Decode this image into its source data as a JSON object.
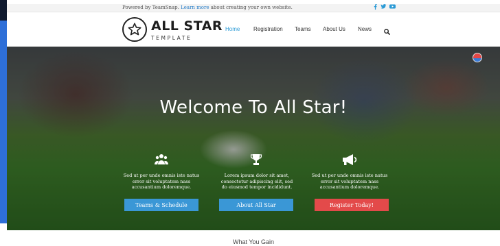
{
  "topbar": {
    "text_prefix": "Powered by TeamSnap. ",
    "link_text": "Learn more",
    "text_suffix": " about creating your own website.",
    "social_icons": [
      "facebook-icon",
      "twitter-icon",
      "youtube-icon"
    ]
  },
  "logo": {
    "main": "ALL STAR",
    "sub": "TEMPLATE"
  },
  "nav": {
    "items": [
      {
        "label": "Home",
        "active": true
      },
      {
        "label": "Registration",
        "active": false
      },
      {
        "label": "Teams",
        "active": false
      },
      {
        "label": "About Us",
        "active": false
      },
      {
        "label": "News",
        "active": false
      }
    ],
    "search_icon": "search-icon"
  },
  "hero": {
    "title": "Welcome To All Star!",
    "columns": [
      {
        "icon": "group-icon",
        "text": "Sed ut per unde omnis iste natus error sit voluptatem nass accusantium doloremque.",
        "button": "Teams & Schedule",
        "button_color": "#3a97d6"
      },
      {
        "icon": "trophy-icon",
        "text": "Lorem ipsum dolor sit amet, consectetur adipiscing elit, sed do eiusmod tempor incididunt.",
        "button": "About All Star",
        "button_color": "#3a97d6"
      },
      {
        "icon": "megaphone-icon",
        "text": "Sed ut per unde omnis iste natus error sit voluptatem nass accusantium doloremque.",
        "button": "Register Today!",
        "button_color": "#e34a4a"
      }
    ]
  },
  "section_below": {
    "title": "What You Gain"
  },
  "colors": {
    "accent": "#2a9ad6",
    "left_strip": "#2e6fd8",
    "register": "#e34a4a"
  }
}
